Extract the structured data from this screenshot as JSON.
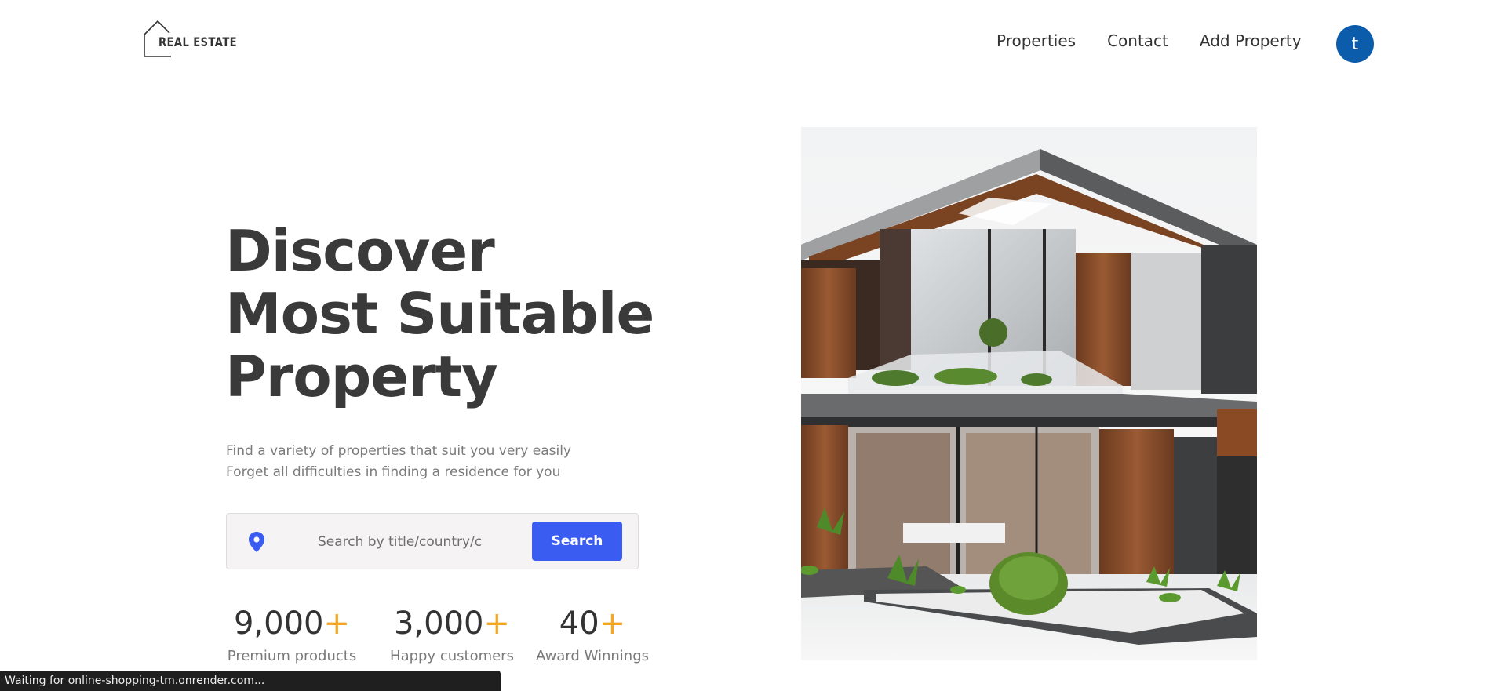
{
  "header": {
    "logo_text": "REAL ESTATE",
    "nav": [
      {
        "label": "Properties"
      },
      {
        "label": "Contact"
      },
      {
        "label": "Add Property"
      }
    ],
    "avatar_letter": "t",
    "avatar_color": "#0b5cab"
  },
  "hero": {
    "title_lines": [
      "Discover",
      "Most Suitable",
      "Property"
    ],
    "subtitle_lines": [
      "Find a variety of properties that suit you very easily",
      "Forget all difficulties in finding a residence for you"
    ]
  },
  "search": {
    "placeholder": "Search by title/country/city",
    "button_label": "Search",
    "button_color": "#3b5cf0",
    "icon": "location-pin-icon"
  },
  "stats": [
    {
      "value": "9,000",
      "suffix": "+",
      "label": "Premium products"
    },
    {
      "value": "3,000",
      "suffix": "+",
      "label": "Happy customers"
    },
    {
      "value": "40",
      "suffix": "+",
      "label": "Award Winnings"
    }
  ],
  "accent_color": "#f5a623",
  "status_bar": {
    "text": "Waiting for online-shopping-tm.onrender.com..."
  }
}
